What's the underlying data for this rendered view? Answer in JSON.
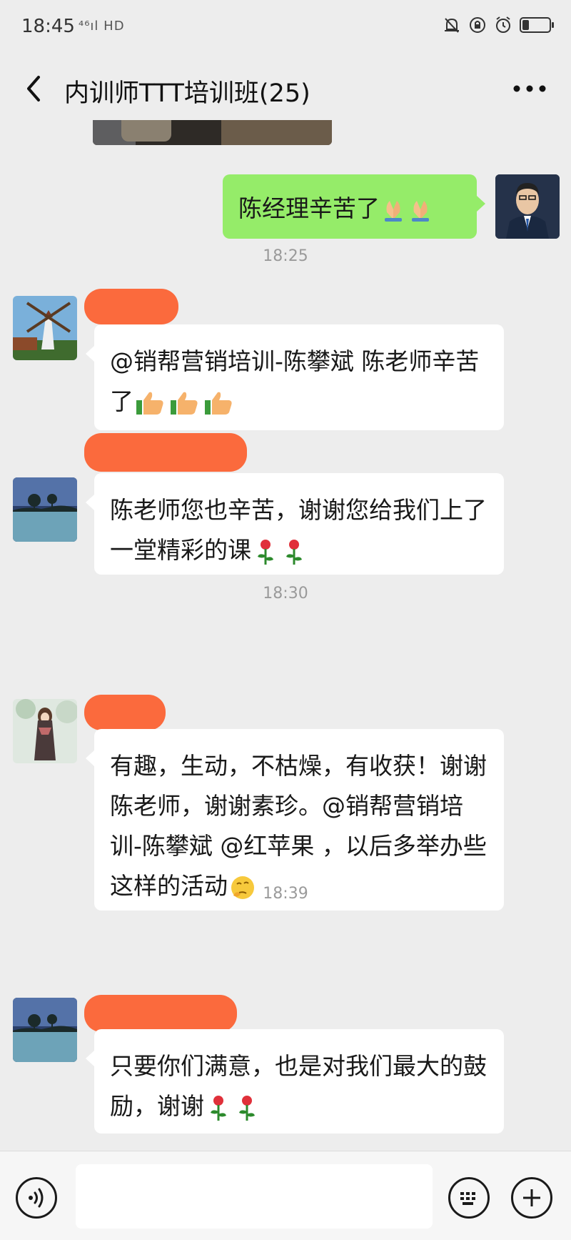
{
  "status_bar": {
    "time": "18:45",
    "signal_text": "⁴⁶ıl HD",
    "battery_level": 0.25
  },
  "header": {
    "title": "内训师TTT培训班(25)"
  },
  "messages": {
    "m1_text": "陈经理辛苦了",
    "ts1": "18:25",
    "m2_text": "@销帮营销培训-陈攀斌  陈老师辛苦了",
    "m3_text": "陈老师您也辛苦，谢谢您给我们上了一堂精彩的课",
    "ts2": "18:30",
    "m4_text": "有趣，生动，不枯燥，有收获！谢谢陈老师，谢谢素珍。@销帮营销培训-陈攀斌  @红苹果 ，以后多举办些这样的活动",
    "ts3": "18:39",
    "m5_text": "只要你们满意，也是对我们最大的鼓励，谢谢"
  },
  "icons": {
    "back": "back-arrow-icon",
    "more": "more-dots-icon",
    "voice": "voice-icon",
    "keyboard": "keyboard-icon",
    "plus": "plus-icon"
  },
  "colors": {
    "outgoing_bubble": "#95ec69",
    "incoming_bubble": "#ffffff",
    "name_redaction": "#fb6a3d",
    "background": "#ededed"
  }
}
